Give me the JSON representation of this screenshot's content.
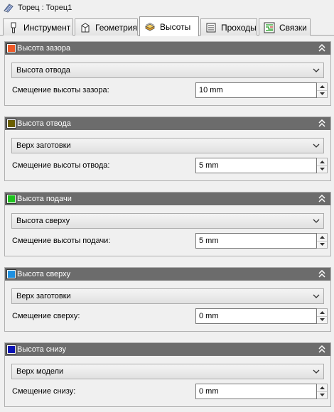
{
  "window": {
    "title": "Торец : Торец1",
    "icon": "toolpath-icon"
  },
  "tabs": [
    {
      "label": "Инструмент",
      "icon": "tool-icon",
      "active": false
    },
    {
      "label": "Геометрия",
      "icon": "geometry-icon",
      "active": false
    },
    {
      "label": "Высоты",
      "icon": "heights-icon",
      "active": true
    },
    {
      "label": "Проходы",
      "icon": "passes-icon",
      "active": false
    },
    {
      "label": "Связки",
      "icon": "links-icon",
      "active": false
    }
  ],
  "panels": [
    {
      "title": "Высота зазора",
      "color": "#f05a28",
      "select": "Высота отвода",
      "offset_label": "Смещение высоты зазора:",
      "offset_value": "10 mm"
    },
    {
      "title": "Высота отвода",
      "color": "#6b5f00",
      "select": "Верх заготовки",
      "offset_label": "Смещение высоты отвода:",
      "offset_value": "5 mm"
    },
    {
      "title": "Высота подачи",
      "color": "#1fc21f",
      "select": "Высота сверху",
      "offset_label": "Смещение высоты подачи:",
      "offset_value": "5 mm"
    },
    {
      "title": "Высота сверху",
      "color": "#1e90e0",
      "select": "Верх заготовки",
      "offset_label": "Смещение сверху:",
      "offset_value": "0 mm"
    },
    {
      "title": "Высота снизу",
      "color": "#0a14b4",
      "select": "Верх модели",
      "offset_label": "Смещение снизу:",
      "offset_value": "0 mm"
    }
  ]
}
